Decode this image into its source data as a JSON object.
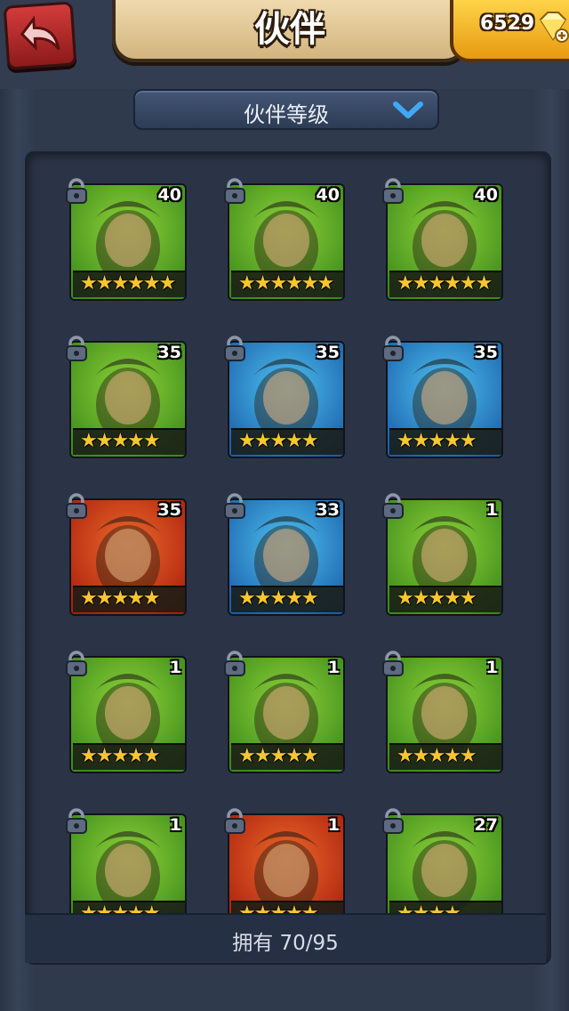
{
  "header": {
    "title": "伙伴",
    "gems": "6529",
    "back_icon": "back-arrow-icon",
    "gem_icon": "diamond-icon"
  },
  "sort_dropdown": {
    "selected": "伙伴等级"
  },
  "footer": {
    "owned_text": "拥有 70/95"
  },
  "colors": {
    "panel_bg": "#2b3447",
    "gem_gold": "#ffd54a",
    "back_red": "#d33b3b",
    "star": "#f8c62f"
  },
  "companions": [
    {
      "level": "40",
      "stars": "★★★★★★",
      "bg": "green"
    },
    {
      "level": "40",
      "stars": "★★★★★★",
      "bg": "green"
    },
    {
      "level": "40",
      "stars": "★★★★★★",
      "bg": "green"
    },
    {
      "level": "35",
      "stars": "★★★★★",
      "bg": "green"
    },
    {
      "level": "35",
      "stars": "★★★★★",
      "bg": "blue"
    },
    {
      "level": "35",
      "stars": "★★★★★",
      "bg": "blue"
    },
    {
      "level": "35",
      "stars": "★★★★★",
      "bg": "red"
    },
    {
      "level": "33",
      "stars": "★★★★★",
      "bg": "blue"
    },
    {
      "level": "1",
      "stars": "★★★★★",
      "bg": "green"
    },
    {
      "level": "1",
      "stars": "★★★★★",
      "bg": "green"
    },
    {
      "level": "1",
      "stars": "★★★★★",
      "bg": "green"
    },
    {
      "level": "1",
      "stars": "★★★★★",
      "bg": "green"
    },
    {
      "level": "1",
      "stars": "★★★★★",
      "bg": "green"
    },
    {
      "level": "1",
      "stars": "★★★★★",
      "bg": "red"
    },
    {
      "level": "27",
      "stars": "★★★★",
      "bg": "green"
    }
  ]
}
